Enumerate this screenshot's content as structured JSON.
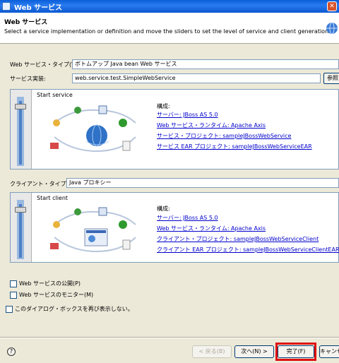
{
  "window": {
    "title": "Web サービス"
  },
  "banner": {
    "title": "Web サービス",
    "description": "Select a service implementation or definition and move the sliders to set the level of service and client generation."
  },
  "service_type": {
    "label": "Web サービス・タイプ(W):",
    "value": "ボトムアップ Java bean Web サービス"
  },
  "service_impl": {
    "label": "サービス実装:",
    "value": "web.service.test.SimpleWebService",
    "browse_label": "参照"
  },
  "service_panel": {
    "slider_label": "Start service",
    "config_heading": "構成:",
    "links": [
      "サーバー: JBoss AS 5.0",
      "Web サービス・ランタイム: Apache Axis",
      "サービス・プロジェクト: sampleJBossWebService",
      "サービス EAR プロジェクト: sampleJBossWebServiceEAR"
    ]
  },
  "client_type": {
    "label": "クライアント・タイプ(C):",
    "value": "Java プロキシー"
  },
  "client_panel": {
    "slider_label": "Start client",
    "config_heading": "構成:",
    "links": [
      "サーバー: JBoss AS 5.0",
      "Web サービス・ランタイム: Apache Axis",
      "クライアント・プロジェクト: sampleJBossWebServiceClient",
      "クライアント EAR プロジェクト: sampleJBossWebServiceClientEAR"
    ]
  },
  "checkboxes": [
    {
      "label": "Web サービスの公開(P)"
    },
    {
      "label": "Web サービスのモニター(M)"
    },
    {
      "label": "このダイアログ・ボックスを再び表示しない。"
    }
  ],
  "footer": {
    "help": "?",
    "back_label": "< 戻る(B)",
    "next_label": "次へ(N) >",
    "finish_label": "完了(F)",
    "cancel_label": "キャンセル"
  },
  "colors": {
    "link": "#0000cc",
    "highlight": "#e01010",
    "titlebar": "#0a5fd8"
  }
}
